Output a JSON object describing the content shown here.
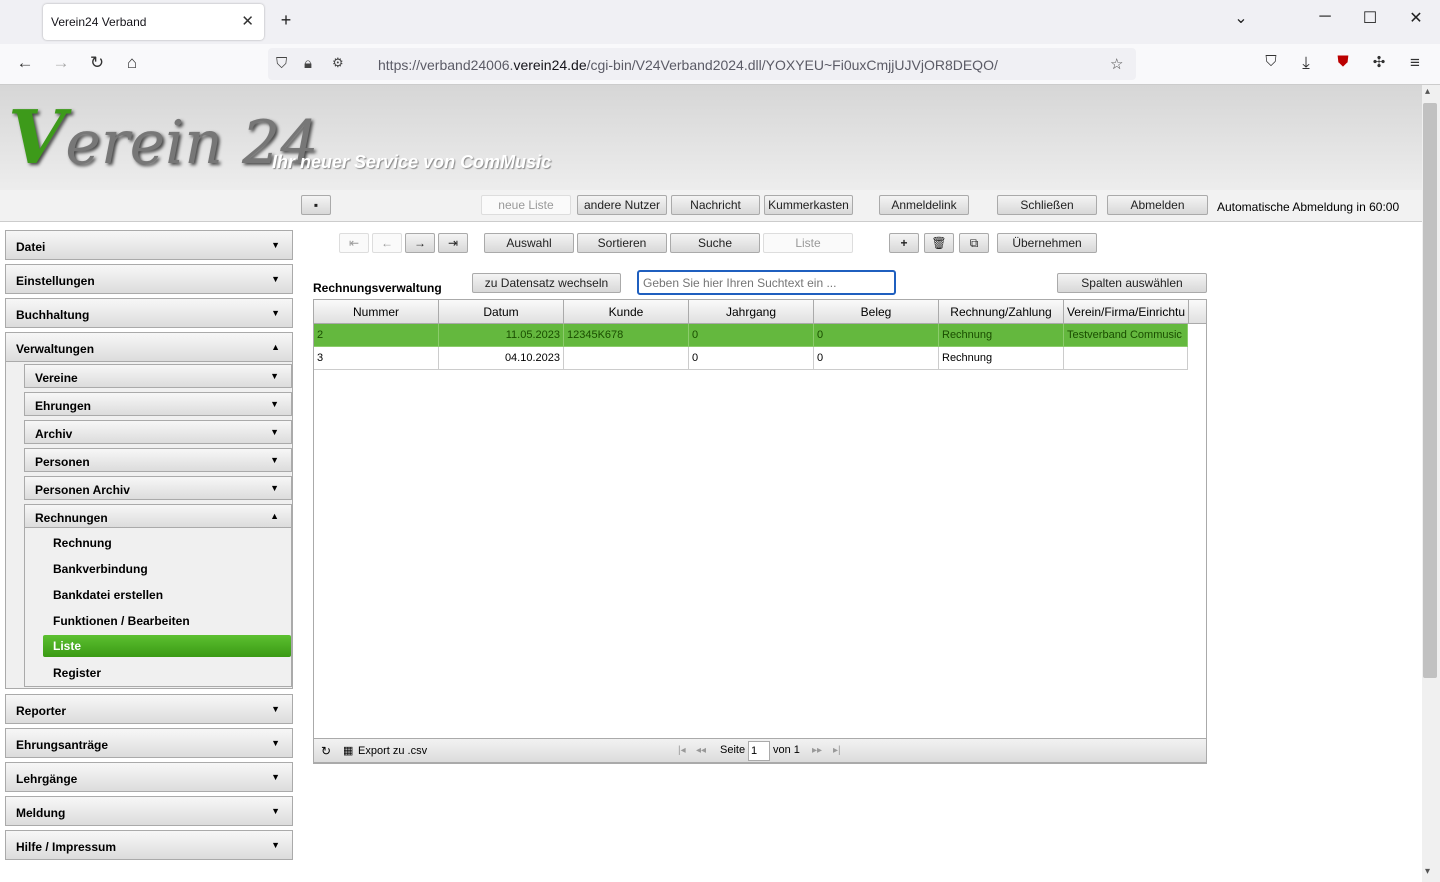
{
  "browser": {
    "tab_title": "Verein24 Verband",
    "url_prefix": "https://verband24006.",
    "url_domain": "verein24.de",
    "url_suffix": "/cgi-bin/V24Verband2024.dll/YOXYEU~Fi0uxCmjjUJVjOR8DEQO/"
  },
  "banner": {
    "logo_v": "V",
    "logo_rest": "erein 24",
    "slogan": "Ihr neuer Service von ComMusic"
  },
  "toolbar": {
    "neue_liste": "neue Liste",
    "andere_nutzer": "andere Nutzer",
    "nachricht": "Nachricht",
    "kummerkasten": "Kummerkasten",
    "anmeldelink": "Anmeldelink",
    "schliessen": "Schließen",
    "abmelden": "Abmelden",
    "auto_logout": "Automatische Abmeldung in 60:00"
  },
  "sidebar": {
    "datei": "Datei",
    "einstellungen": "Einstellungen",
    "buchhaltung": "Buchhaltung",
    "verwaltungen": "Verwaltungen",
    "vereine": "Vereine",
    "ehrungen": "Ehrungen",
    "archiv": "Archiv",
    "personen": "Personen",
    "personen_archiv": "Personen Archiv",
    "rechnungen": "Rechnungen",
    "rechnung": "Rechnung",
    "bankverbindung": "Bankverbindung",
    "bankdatei": "Bankdatei erstellen",
    "funktionen": "Funktionen / Bearbeiten",
    "liste": "Liste",
    "register": "Register",
    "reporter": "Reporter",
    "ehrungsantraege": "Ehrungsanträge",
    "lehrgaenge": "Lehrgänge",
    "meldung": "Meldung",
    "hilfe": "Hilfe / Impressum"
  },
  "actions": {
    "auswahl": "Auswahl",
    "sortieren": "Sortieren",
    "suche": "Suche",
    "liste": "Liste",
    "plus": "+",
    "uebernehmen": "Übernehmen"
  },
  "main": {
    "title": "Rechnungsverwaltung",
    "switch_button": "zu Datensatz wechseln",
    "search_placeholder": "Geben Sie hier Ihren Suchtext ein ...",
    "columns_button": "Spalten auswählen"
  },
  "table": {
    "columns": [
      "Nummer",
      "Datum",
      "Kunde",
      "Jahrgang",
      "Beleg",
      "Rechnung/Zahlung",
      "Verein/Firma/Einrichtu"
    ],
    "rows": [
      [
        "2",
        "11.05.2023",
        "12345K678",
        "0",
        "0",
        "Rechnung",
        "Testverband Commusic"
      ],
      [
        "3",
        "04.10.2023",
        "",
        "0",
        "0",
        "Rechnung",
        ""
      ]
    ]
  },
  "footer": {
    "export": "Export zu .csv",
    "seite": "Seite",
    "page": "1",
    "von": "von 1"
  }
}
